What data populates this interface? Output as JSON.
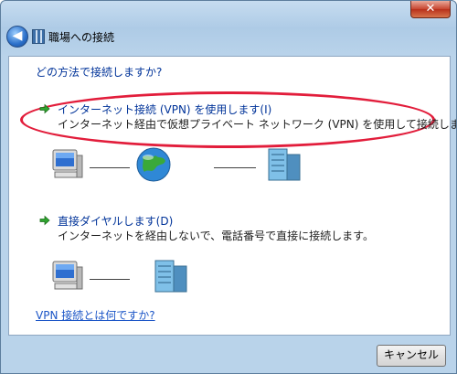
{
  "window": {
    "close_symbol": "✕"
  },
  "nav": {
    "back_symbol": "◀",
    "title": "職場への接続"
  },
  "main": {
    "question": "どの方法で接続しますか?",
    "options": [
      {
        "title": "インターネット接続 (VPN) を使用します(I)",
        "description": "インターネット経由で仮想プライベート ネットワーク (VPN) を使用して接続します。"
      },
      {
        "title": "直接ダイヤルします(D)",
        "description": "インターネットを経由しないで、電話番号で直接に接続します。"
      }
    ],
    "help_link": "VPN 接続とは何ですか?"
  },
  "footer": {
    "cancel_label": "キャンセル"
  },
  "colors": {
    "accent": "#003399",
    "link": "#1c56c7",
    "highlight": "#e21d3b"
  }
}
